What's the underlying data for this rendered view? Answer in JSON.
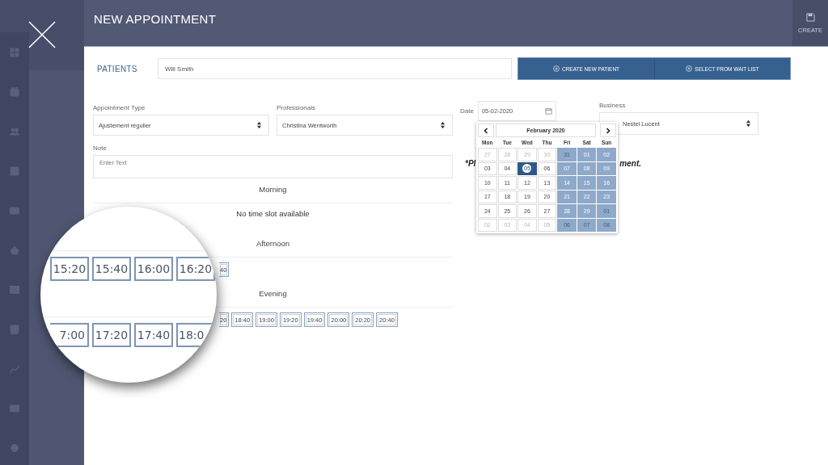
{
  "header": {
    "title": "NEW APPOINTMENT",
    "action": "CREATE"
  },
  "patients": {
    "label": "PATIENTS",
    "value": "Will Smith",
    "buttons": [
      "CREATE NEW PATIENT",
      "SELECT FROM WAIT LIST"
    ]
  },
  "appointment_type": {
    "label": "Appointment Type",
    "value": "Ajustement régulier"
  },
  "professionals": {
    "label": "Professionals",
    "value": "Christina Wentworth"
  },
  "date": {
    "label": "Date",
    "value": "05-02-2020"
  },
  "business": {
    "label": "Business",
    "value": "Nestel Lucent"
  },
  "note": {
    "label": "Note",
    "placeholder": "Enter Text"
  },
  "hint_fragments": [
    "*Pl",
    "ment."
  ],
  "sections": [
    {
      "title": "Morning",
      "empty": "No time slot available"
    },
    {
      "title": "Afternoon",
      "slots": [
        "40"
      ]
    },
    {
      "title": "Evening",
      "slots": [
        "20",
        "18:40",
        "19:00",
        "19:20",
        "19:40",
        "20:00",
        "20:20",
        "20:40"
      ]
    }
  ],
  "magnifier": {
    "rows": [
      [
        "15:20",
        "15:40",
        "16:00",
        "16:20"
      ],
      [
        "7:00",
        "17:20",
        "17:40",
        "18:0"
      ]
    ]
  },
  "calendar": {
    "month": "February 2020",
    "weekdays": [
      "Mon",
      "Tue",
      "Wed",
      "Thu",
      "Fri",
      "Sat",
      "Sun"
    ],
    "days": [
      {
        "day": "27",
        "outside": true,
        "blocked": false,
        "selected": false
      },
      {
        "day": "28",
        "outside": true,
        "blocked": false,
        "selected": false
      },
      {
        "day": "29",
        "outside": true,
        "blocked": false,
        "selected": false
      },
      {
        "day": "30",
        "outside": true,
        "blocked": false,
        "selected": false
      },
      {
        "day": "31",
        "outside": true,
        "blocked": true,
        "selected": false
      },
      {
        "day": "01",
        "outside": false,
        "blocked": true,
        "selected": false
      },
      {
        "day": "02",
        "outside": false,
        "blocked": true,
        "selected": false
      },
      {
        "day": "03",
        "outside": false,
        "blocked": false,
        "selected": false
      },
      {
        "day": "04",
        "outside": false,
        "blocked": false,
        "selected": false
      },
      {
        "day": "05",
        "outside": false,
        "blocked": false,
        "selected": true
      },
      {
        "day": "06",
        "outside": false,
        "blocked": false,
        "selected": false
      },
      {
        "day": "07",
        "outside": false,
        "blocked": true,
        "selected": false
      },
      {
        "day": "08",
        "outside": false,
        "blocked": true,
        "selected": false
      },
      {
        "day": "09",
        "outside": false,
        "blocked": true,
        "selected": false
      },
      {
        "day": "10",
        "outside": false,
        "blocked": false,
        "selected": false
      },
      {
        "day": "11",
        "outside": false,
        "blocked": false,
        "selected": false
      },
      {
        "day": "12",
        "outside": false,
        "blocked": false,
        "selected": false
      },
      {
        "day": "13",
        "outside": false,
        "blocked": false,
        "selected": false
      },
      {
        "day": "14",
        "outside": false,
        "blocked": true,
        "selected": false
      },
      {
        "day": "15",
        "outside": false,
        "blocked": true,
        "selected": false
      },
      {
        "day": "16",
        "outside": false,
        "blocked": true,
        "selected": false
      },
      {
        "day": "17",
        "outside": false,
        "blocked": false,
        "selected": false
      },
      {
        "day": "18",
        "outside": false,
        "blocked": false,
        "selected": false
      },
      {
        "day": "19",
        "outside": false,
        "blocked": false,
        "selected": false
      },
      {
        "day": "20",
        "outside": false,
        "blocked": false,
        "selected": false
      },
      {
        "day": "21",
        "outside": false,
        "blocked": true,
        "selected": false
      },
      {
        "day": "22",
        "outside": false,
        "blocked": true,
        "selected": false
      },
      {
        "day": "23",
        "outside": false,
        "blocked": true,
        "selected": false
      },
      {
        "day": "24",
        "outside": false,
        "blocked": false,
        "selected": false
      },
      {
        "day": "25",
        "outside": false,
        "blocked": false,
        "selected": false
      },
      {
        "day": "26",
        "outside": false,
        "blocked": false,
        "selected": false
      },
      {
        "day": "27",
        "outside": false,
        "blocked": false,
        "selected": false
      },
      {
        "day": "28",
        "outside": false,
        "blocked": true,
        "selected": false
      },
      {
        "day": "29",
        "outside": false,
        "blocked": true,
        "selected": false
      },
      {
        "day": "01",
        "outside": true,
        "blocked": true,
        "selected": false
      },
      {
        "day": "02",
        "outside": true,
        "blocked": false,
        "selected": false
      },
      {
        "day": "03",
        "outside": true,
        "blocked": false,
        "selected": false
      },
      {
        "day": "04",
        "outside": true,
        "blocked": false,
        "selected": false
      },
      {
        "day": "05",
        "outside": true,
        "blocked": false,
        "selected": false
      },
      {
        "day": "06",
        "outside": true,
        "blocked": true,
        "selected": false
      },
      {
        "day": "07",
        "outside": true,
        "blocked": true,
        "selected": false
      },
      {
        "day": "08",
        "outside": true,
        "blocked": true,
        "selected": false
      }
    ]
  }
}
